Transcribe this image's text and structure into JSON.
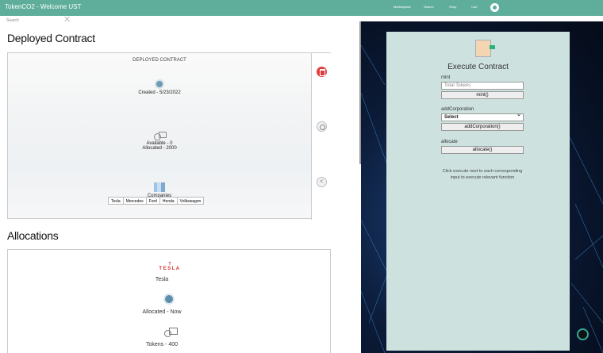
{
  "app": {
    "title": "TokenCO2 - Welcome UST"
  },
  "nav": {
    "items": [
      "Marketplace",
      "Search",
      "Shop",
      "Cart"
    ]
  },
  "search": {
    "label": "Search"
  },
  "deployed": {
    "section_title": "Deployed Contract",
    "header": "DEPLOYED CONTRACT",
    "created": "Created - 5/23/2022",
    "available": "Available - 0",
    "allocated": "Allocated - 2000",
    "companies_label": "Companies",
    "companies": [
      "Tesla",
      "Mercedes",
      "Ford",
      "Honda",
      "Volkswagon"
    ]
  },
  "allocations": {
    "section_title": "Allocations",
    "logo_letter": "T",
    "logo_text": "TESLA",
    "company": "Tesla",
    "allocated": "Allocated - Now",
    "tokens": "Tokens - 400"
  },
  "execute": {
    "title": "Execute Contract",
    "mint_label": "mint",
    "mint_placeholder": "Total Tokens",
    "mint_button": "mint()",
    "corp_label": "addCorporation",
    "corp_select": "Select",
    "corp_button": "addCorporation()",
    "allocate_label": "allocate",
    "allocate_button": "allocate()",
    "hint": "Click execute next to each corresponding input to execute relevant function"
  },
  "colors": {
    "topbar": "#5fae9b",
    "panel": "#cde2df",
    "delete": "#e23b3b"
  }
}
